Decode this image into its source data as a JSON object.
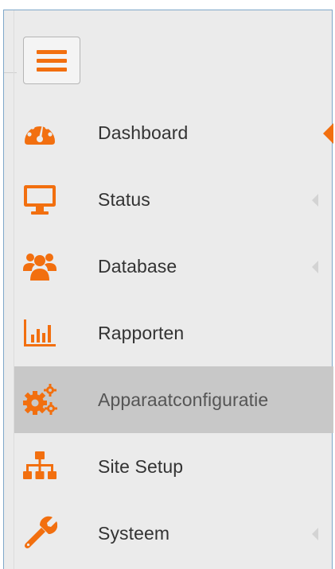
{
  "colors": {
    "accent": "#f26f0f",
    "sidebar_background": "#ebebeb",
    "selected_background": "#c8c8c8",
    "text": "#333333"
  },
  "toolbar": {
    "menu_toggle_icon": "hamburger-icon"
  },
  "sidebar": {
    "items": [
      {
        "label": "Dashboard",
        "icon": "dashboard-icon",
        "active": true,
        "has_submenu": true,
        "selected": false
      },
      {
        "label": "Status",
        "icon": "monitor-icon",
        "active": false,
        "has_submenu": true,
        "selected": false
      },
      {
        "label": "Database",
        "icon": "users-icon",
        "active": false,
        "has_submenu": true,
        "selected": false
      },
      {
        "label": "Rapporten",
        "icon": "bar-chart-icon",
        "active": false,
        "has_submenu": false,
        "selected": false
      },
      {
        "label": "Apparaatconfiguratie",
        "icon": "gears-icon",
        "active": false,
        "has_submenu": false,
        "selected": true
      },
      {
        "label": "Site Setup",
        "icon": "sitemap-icon",
        "active": false,
        "has_submenu": false,
        "selected": false
      },
      {
        "label": "Systeem",
        "icon": "wrench-icon",
        "active": false,
        "has_submenu": true,
        "selected": false
      }
    ]
  }
}
